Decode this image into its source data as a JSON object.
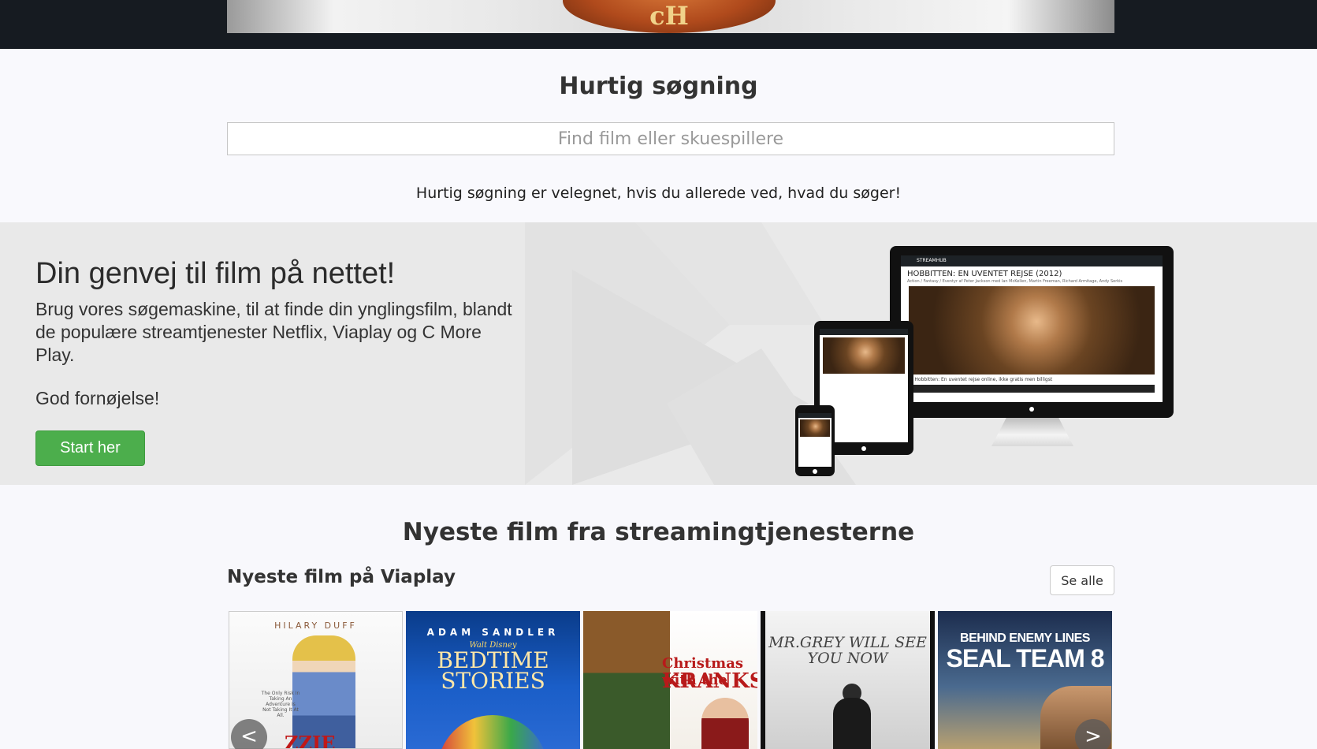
{
  "banner": {
    "logo_text": "cH"
  },
  "quick_search": {
    "title": "Hurtig søgning",
    "placeholder": "Find film eller skuespillere",
    "hint": "Hurtig søgning er velegnet, hvis du allerede ved, hvad du søger!"
  },
  "hero": {
    "title": "Din genvej til film på nettet!",
    "text": "Brug vores søgemaskine, til at finde din ynglingsfilm, blandt de populære streamtjenester Netflix, Viaplay og C More Play.",
    "greeting": "God fornøjelse!",
    "button_label": "Start her",
    "button_color": "#4cae4c",
    "device_mockup": {
      "brand": "STREAMHUB",
      "page_heading": "HOBBITTEN: EN UVENTET REJSE (2012)",
      "page_sub": "Action / Fantasy / Eventyr af Peter Jackson med Ian McKellen, Martin Freeman, Richard Armitage, Andy Serkis",
      "caption": "Se Hobbitten: En uventet rejse online, ikke gratis men billigst"
    }
  },
  "newest": {
    "title": "Nyeste film fra streamingtjenesterne",
    "subtitle": "Nyeste film på Viaplay",
    "see_all_label": "Se alle",
    "prev_label": "<",
    "next_label": ">",
    "posters": [
      {
        "actor": "HILARY DUFF",
        "tagline": "The Only Risk In Taking An Adventure Is Not Taking It At All.",
        "logo": "ZZIE"
      },
      {
        "actor": "ADAM SANDLER",
        "studio": "Walt Disney",
        "title": "BEDTIME STORIES"
      },
      {
        "title_line1": "Christmas with the",
        "title_line2": "KRANKS"
      },
      {
        "title": "MR.GREY WILL SEE YOU NOW"
      },
      {
        "title_line1": "BEHIND ENEMY LINES",
        "title_line2": "SEAL TEAM 8"
      }
    ]
  }
}
